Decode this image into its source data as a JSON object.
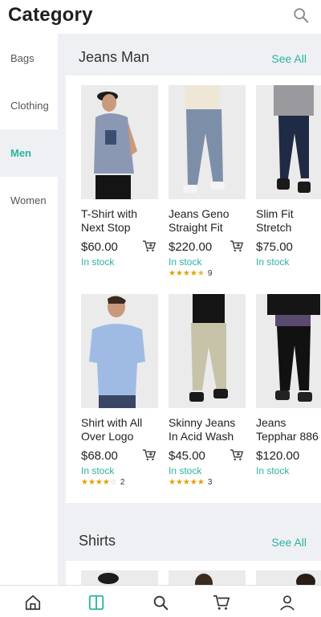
{
  "header": {
    "title": "Category",
    "search_icon": "search-icon"
  },
  "sidebar": {
    "items": [
      {
        "label": "Bags",
        "active": false
      },
      {
        "label": "Clothing",
        "active": false
      },
      {
        "label": "Men",
        "active": true
      },
      {
        "label": "Women",
        "active": false
      }
    ]
  },
  "sections": [
    {
      "title": "Jeans Man",
      "see_all": "See All",
      "products": [
        {
          "name": "T-Shirt with\nNext Stop",
          "price": "$60.00",
          "stock": "In stock",
          "rating": 0,
          "reviews": ""
        },
        {
          "name": "Jeans Geno\nStraight Fit",
          "price": "$220.00",
          "stock": "In stock",
          "rating": 4.5,
          "reviews": "9"
        },
        {
          "name": "Slim Fit\nStretch",
          "price": "$75.00",
          "stock": "In stock",
          "rating": 0,
          "reviews": ""
        },
        {
          "name": "Shirt with All\nOver Logo",
          "price": "$68.00",
          "stock": "In stock",
          "rating": 4,
          "reviews": "2"
        },
        {
          "name": "Skinny Jeans\nIn Acid Wash",
          "price": "$45.00",
          "stock": "In stock",
          "rating": 5,
          "reviews": "3"
        },
        {
          "name": "Jeans\nTepphar 886",
          "price": "$120.00",
          "stock": "In stock",
          "rating": 0,
          "reviews": ""
        }
      ]
    },
    {
      "title": "Shirts",
      "see_all": "See All",
      "products": []
    }
  ],
  "bottom_nav": [
    "home-icon",
    "catalog-icon",
    "search-icon",
    "cart-icon",
    "profile-icon"
  ],
  "colors": {
    "accent": "#2bb3a0",
    "star": "#e0a100",
    "panel_bg": "#eef0f3"
  }
}
